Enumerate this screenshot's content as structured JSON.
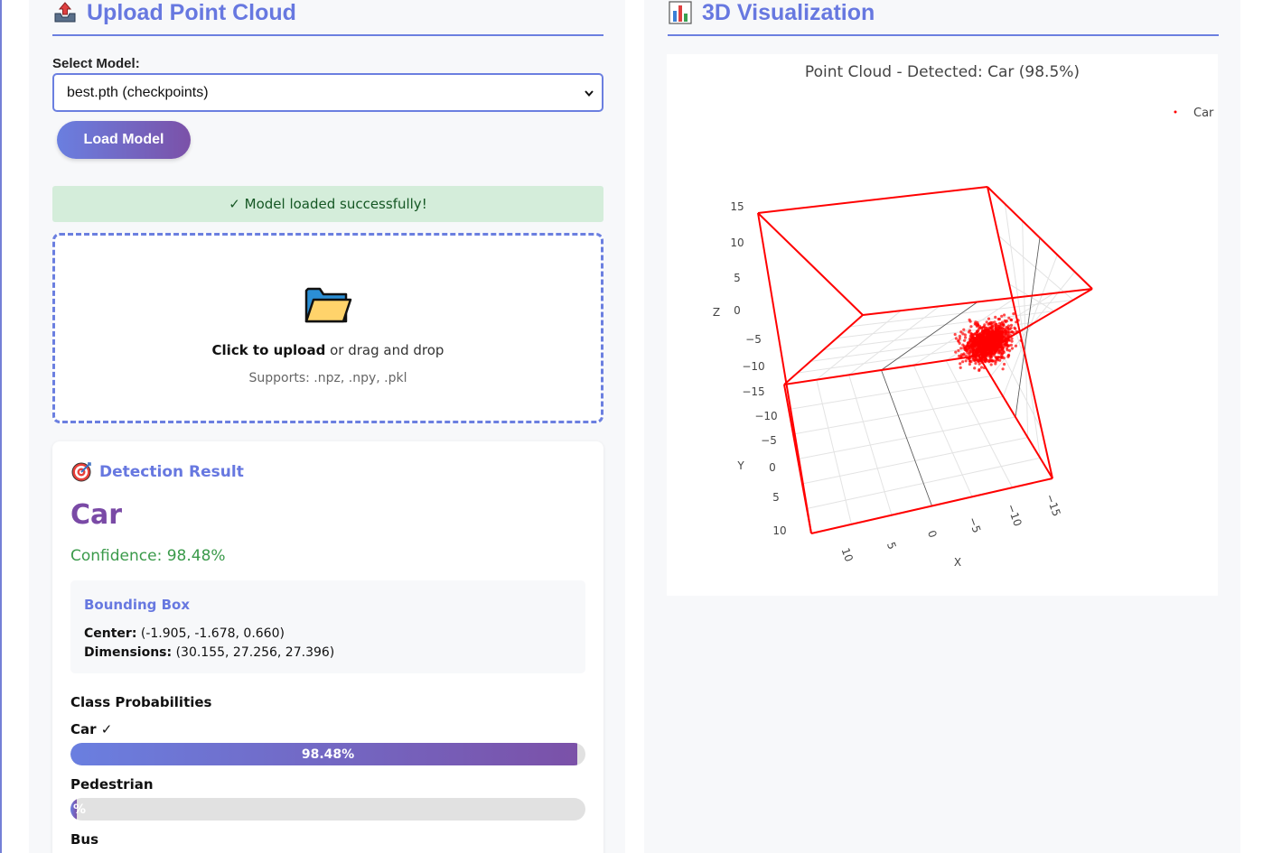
{
  "upload_panel": {
    "title": "Upload Point Cloud",
    "select_label": "Select Model:",
    "selected_model": "best.pth (checkpoints)",
    "load_button": "Load Model",
    "status_message": "✓ Model loaded successfully!",
    "dropzone": {
      "click_text": "Click to upload",
      "rest_text": " or drag and drop",
      "supports": "Supports: .npz, .npy, .pkl"
    }
  },
  "result": {
    "title": "Detection Result",
    "class_name": "Car",
    "confidence": "Confidence: 98.48%",
    "bounding_box": {
      "title": "Bounding Box",
      "center_label": "Center:",
      "center_value": " (-1.905, -1.678, 0.660)",
      "dimensions_label": "Dimensions:",
      "dimensions_value": " (30.155, 27.256, 27.396)"
    },
    "probabilities_title": "Class Probabilities",
    "probabilities": [
      {
        "label": "Car ✓",
        "value": 98.48,
        "text": "98.48%"
      },
      {
        "label": "Pedestrian",
        "value": 1.2,
        "text": "%"
      },
      {
        "label": "Bus",
        "value": 0,
        "text": ""
      }
    ]
  },
  "viz_panel": {
    "title": "3D Visualization"
  },
  "chart_data": {
    "type": "scatter",
    "title": "Point Cloud - Detected: Car (98.5%)",
    "legend": [
      "Car"
    ],
    "legend_position": "top-right",
    "series": [
      {
        "name": "Car",
        "color": "#ff0000"
      }
    ],
    "axes": {
      "x": {
        "label": "X",
        "ticks": [
          "10",
          "5",
          "0",
          "−5",
          "−10",
          "−15"
        ]
      },
      "y": {
        "label": "Y",
        "ticks": [
          "−10",
          "−5",
          "0",
          "5",
          "10"
        ]
      },
      "z": {
        "label": "Z",
        "ticks": [
          "15",
          "10",
          "5",
          "0",
          "−5",
          "−10",
          "−15"
        ]
      }
    },
    "bounding_box_color": "#ff0000",
    "grid": true
  },
  "colors": {
    "accent": "#6778e0",
    "brand_purple": "#7a4aa6",
    "success_bg": "#d4edda",
    "success_text": "#155724",
    "confidence_green": "#3a9a4a"
  }
}
